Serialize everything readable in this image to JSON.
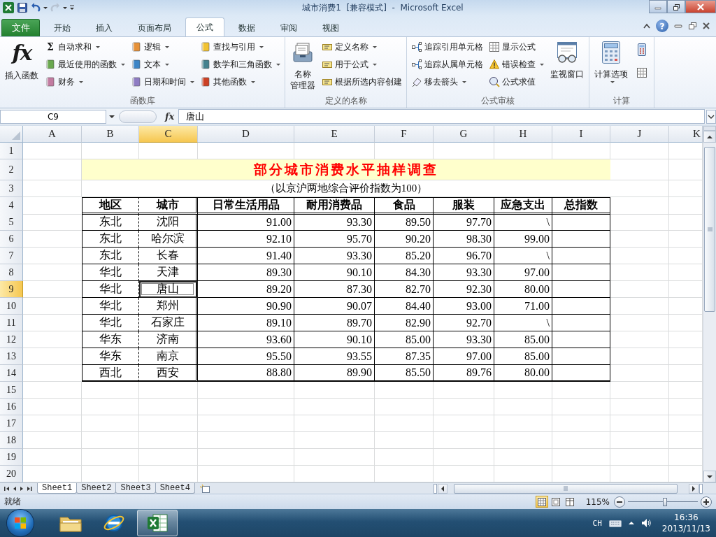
{
  "window": {
    "title": "城市消费1  [兼容模式]  -  Microsoft Excel"
  },
  "ribbon_tabs": [
    {
      "label": "文件",
      "kind": "file",
      "selected": false
    },
    {
      "label": "开始",
      "kind": "tab",
      "selected": false
    },
    {
      "label": "插入",
      "kind": "tab",
      "selected": false
    },
    {
      "label": "页面布局",
      "kind": "tab",
      "selected": false
    },
    {
      "label": "公式",
      "kind": "tab",
      "selected": true
    },
    {
      "label": "数据",
      "kind": "tab",
      "selected": false
    },
    {
      "label": "审阅",
      "kind": "tab",
      "selected": false
    },
    {
      "label": "视图",
      "kind": "tab",
      "selected": false
    }
  ],
  "help": "?",
  "ribbon_groups": [
    {
      "label": "函数库",
      "columns": [
        [
          {
            "kind": "large",
            "icon_text": "fx",
            "lines": [
              "插入函数"
            ],
            "dropdown": false
          }
        ],
        [
          {
            "kind": "small",
            "icon_text": "Σ",
            "label": "自动求和",
            "dropdown": true
          },
          {
            "kind": "small",
            "label": "最近使用的函数",
            "dropdown": true
          },
          {
            "kind": "small",
            "label": "财务",
            "dropdown": true
          }
        ],
        [
          {
            "kind": "small",
            "label": "逻辑",
            "dropdown": true
          },
          {
            "kind": "small",
            "label": "文本",
            "dropdown": true
          },
          {
            "kind": "small",
            "label": "日期和时间",
            "dropdown": true
          }
        ],
        [
          {
            "kind": "small",
            "label": "查找与引用",
            "dropdown": true
          },
          {
            "kind": "small",
            "label": "数学和三角函数",
            "dropdown": true
          },
          {
            "kind": "small",
            "label": "其他函数",
            "dropdown": true
          }
        ]
      ]
    },
    {
      "label": "定义的名称",
      "columns": [
        [
          {
            "kind": "large",
            "lines": [
              "名称",
              "管理器"
            ],
            "dropdown": false
          }
        ],
        [
          {
            "kind": "small",
            "label": "定义名称",
            "dropdown": true
          },
          {
            "kind": "small",
            "label": "用于公式",
            "dropdown": true
          },
          {
            "kind": "small",
            "label": "根据所选内容创建",
            "dropdown": false
          }
        ]
      ]
    },
    {
      "label": "公式审核",
      "columns": [
        [
          {
            "kind": "small",
            "label": "追踪引用单元格",
            "dropdown": false
          },
          {
            "kind": "small",
            "label": "追踪从属单元格",
            "dropdown": false
          },
          {
            "kind": "small",
            "label": "移去箭头",
            "dropdown": true
          }
        ],
        [
          {
            "kind": "small",
            "label": "显示公式",
            "dropdown": false
          },
          {
            "kind": "small",
            "label": "错误检查",
            "dropdown": true
          },
          {
            "kind": "small",
            "label": "公式求值",
            "dropdown": false
          }
        ],
        [
          {
            "kind": "large",
            "lines": [
              "监视窗口"
            ],
            "dropdown": false
          }
        ]
      ]
    },
    {
      "label": "计算",
      "columns": [
        [
          {
            "kind": "large",
            "lines": [
              "计算选项"
            ],
            "dropdown": true
          }
        ],
        [
          {
            "kind": "icon"
          },
          {
            "kind": "icon"
          }
        ]
      ]
    }
  ],
  "formula_bar": {
    "name_box": "C9",
    "function_button": "fx",
    "content": "唐山"
  },
  "sheet": {
    "columns": [
      {
        "label": "A",
        "selected": false
      },
      {
        "label": "B",
        "selected": false
      },
      {
        "label": "C",
        "selected": true
      },
      {
        "label": "D",
        "selected": false
      },
      {
        "label": "E",
        "selected": false
      },
      {
        "label": "F",
        "selected": false
      },
      {
        "label": "G",
        "selected": false
      },
      {
        "label": "H",
        "selected": false
      },
      {
        "label": "I",
        "selected": false
      },
      {
        "label": "J",
        "selected": false
      },
      {
        "label": "K",
        "selected": false
      }
    ],
    "rows": [
      {
        "label": "1",
        "selected": false,
        "kind": "blank"
      },
      {
        "label": "2",
        "selected": false,
        "kind": "title",
        "text": "部分城市消费水平抽样调查"
      },
      {
        "label": "3",
        "selected": false,
        "kind": "subtitle",
        "text": "（以京沪两地综合评价指数为100）"
      },
      {
        "label": "4",
        "selected": false,
        "kind": "header",
        "cells": [
          "地区",
          "城市",
          "日常生活用品",
          "耐用消费品",
          "食品",
          "服装",
          "应急支出",
          "总指数"
        ]
      },
      {
        "label": "5",
        "selected": false,
        "kind": "data",
        "cells": [
          "东北",
          "沈阳",
          "91.00",
          "93.30",
          "89.50",
          "97.70",
          "\\"
        ]
      },
      {
        "label": "6",
        "selected": false,
        "kind": "data",
        "cells": [
          "东北",
          "哈尔滨",
          "92.10",
          "95.70",
          "90.20",
          "98.30",
          "99.00"
        ]
      },
      {
        "label": "7",
        "selected": false,
        "kind": "data",
        "cells": [
          "东北",
          "长春",
          "91.40",
          "93.30",
          "85.20",
          "96.70",
          "\\"
        ]
      },
      {
        "label": "8",
        "selected": false,
        "kind": "data",
        "cells": [
          "华北",
          "天津",
          "89.30",
          "90.10",
          "84.30",
          "93.30",
          "97.00"
        ]
      },
      {
        "label": "9",
        "selected": true,
        "kind": "data",
        "cells": [
          "华北",
          "唐山",
          "89.20",
          "87.30",
          "82.70",
          "92.30",
          "80.00"
        ]
      },
      {
        "label": "10",
        "selected": false,
        "kind": "data",
        "cells": [
          "华北",
          "郑州",
          "90.90",
          "90.07",
          "84.40",
          "93.00",
          "71.00"
        ]
      },
      {
        "label": "11",
        "selected": false,
        "kind": "data",
        "cells": [
          "华北",
          "石家庄",
          "89.10",
          "89.70",
          "82.90",
          "92.70",
          "\\"
        ]
      },
      {
        "label": "12",
        "selected": false,
        "kind": "data",
        "cells": [
          "华东",
          "济南",
          "93.60",
          "90.10",
          "85.00",
          "93.30",
          "85.00"
        ]
      },
      {
        "label": "13",
        "selected": false,
        "kind": "data",
        "cells": [
          "华东",
          "南京",
          "95.50",
          "93.55",
          "87.35",
          "97.00",
          "85.00"
        ]
      },
      {
        "label": "14",
        "selected": false,
        "kind": "data",
        "cells": [
          "西北",
          "西安",
          "88.80",
          "89.90",
          "85.50",
          "89.76",
          "80.00"
        ]
      },
      {
        "label": "15",
        "selected": false,
        "kind": "blank"
      },
      {
        "label": "16",
        "selected": false,
        "kind": "blank"
      },
      {
        "label": "17",
        "selected": false,
        "kind": "blank"
      },
      {
        "label": "18",
        "selected": false,
        "kind": "blank"
      },
      {
        "label": "19",
        "selected": false,
        "kind": "blank"
      },
      {
        "label": "20",
        "selected": false,
        "kind": "blank"
      }
    ]
  },
  "sheet_tabs": [
    {
      "label": "Sheet1",
      "selected": true
    },
    {
      "label": "Sheet2",
      "selected": false
    },
    {
      "label": "Sheet3",
      "selected": false
    },
    {
      "label": "Sheet4",
      "selected": false
    }
  ],
  "status_bar": {
    "text": "就绪",
    "views": [
      {
        "kind": "normal",
        "selected": true
      },
      {
        "kind": "page-layout",
        "selected": false
      },
      {
        "kind": "page-break",
        "selected": false
      }
    ],
    "zoom": "115%",
    "zoom_slider": {
      "level": 0.53
    }
  },
  "taskbar": {
    "apps": [
      {
        "kind": "folder",
        "selected": false
      },
      {
        "kind": "browser",
        "selected": false
      },
      {
        "kind": "spreadsheet",
        "selected": true
      }
    ],
    "language": "CH",
    "time": "16:36",
    "date": "2013/11/13"
  }
}
